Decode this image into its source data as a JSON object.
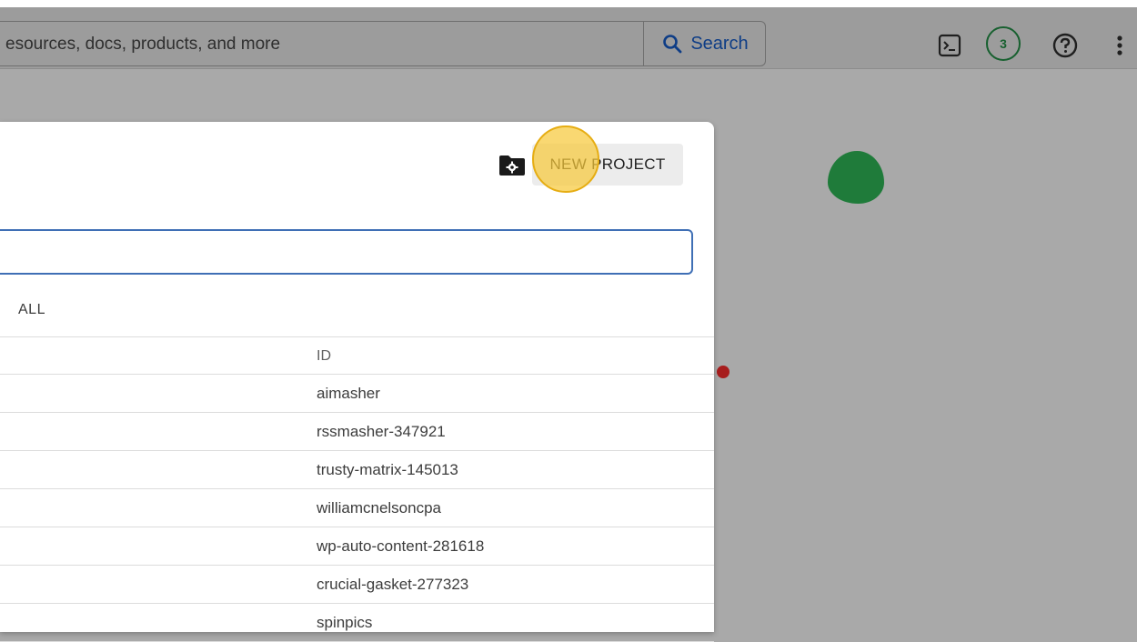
{
  "topbar": {
    "search_placeholder": "esources, docs, products, and more",
    "search_button_label": "Search",
    "notification_count": "3"
  },
  "dialog": {
    "new_project_label": "NEW PROJECT",
    "tab_all_label": "ALL",
    "table": {
      "columns": [
        "ID"
      ],
      "rows": [
        {
          "id": "aimasher"
        },
        {
          "id": "rssmasher-347921"
        },
        {
          "id": "trusty-matrix-145013"
        },
        {
          "id": "williamcnelsoncpa"
        },
        {
          "id": "wp-auto-content-281618"
        },
        {
          "id": "crucial-gasket-277323"
        },
        {
          "id": "spinpics"
        }
      ]
    }
  },
  "colors": {
    "accent_blue": "#0e3d86",
    "badge_green": "#17602f",
    "highlight_yellow": "#f7c93c"
  },
  "icons": {
    "search": "search-icon",
    "terminal": "terminal-icon",
    "help": "help-icon",
    "more": "more-vert-icon",
    "folder_settings": "folder-settings-icon"
  }
}
